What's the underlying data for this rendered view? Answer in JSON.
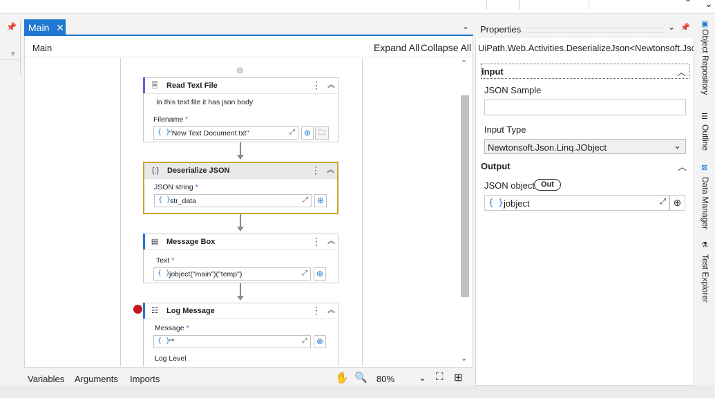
{
  "designer": {
    "tab_label": "Main",
    "breadcrumb": "Main",
    "expand_all": "Expand All",
    "collapse_all": "Collapse All",
    "zoom": "80%",
    "bottom_tabs": [
      "Variables",
      "Arguments",
      "Imports"
    ]
  },
  "activities": {
    "read_text_file": {
      "title": "Read Text File",
      "annotation": "In this text file it has json body",
      "filename_label": "Filename",
      "filename_value": "\"New Text Document.txt\""
    },
    "deserialize_json": {
      "title": "Deserialize JSON",
      "json_string_label": "JSON string",
      "json_string_value": "str_data"
    },
    "message_box": {
      "title": "Message Box",
      "text_label": "Text",
      "text_value": "jobject(\"main\")(\"temp\")"
    },
    "log_message": {
      "title": "Log Message",
      "message_label": "Message",
      "message_value": "\"\"",
      "log_level_label": "Log Level"
    },
    "required_mark": "*"
  },
  "properties": {
    "title": "Properties",
    "type_name": "UiPath.Web.Activities.DeserializeJson<Newtonsoft.Json.Linq.JObject>",
    "input_section": "Input",
    "json_sample_label": "JSON Sample",
    "json_sample_value": "",
    "input_type_label": "Input Type",
    "input_type_value": "Newtonsoft.Json.Linq.JObject",
    "output_section": "Output",
    "json_object_label": "JSON object",
    "out_badge": "Out",
    "json_object_value": "jobject"
  },
  "right_sidebar": [
    "Object Repository",
    "Outline",
    "Data Manager",
    "Test Explorer"
  ],
  "colors": {
    "accent": "#1f78d1",
    "selected_border": "#c4a52a",
    "breakpoint": "#c4161c"
  }
}
